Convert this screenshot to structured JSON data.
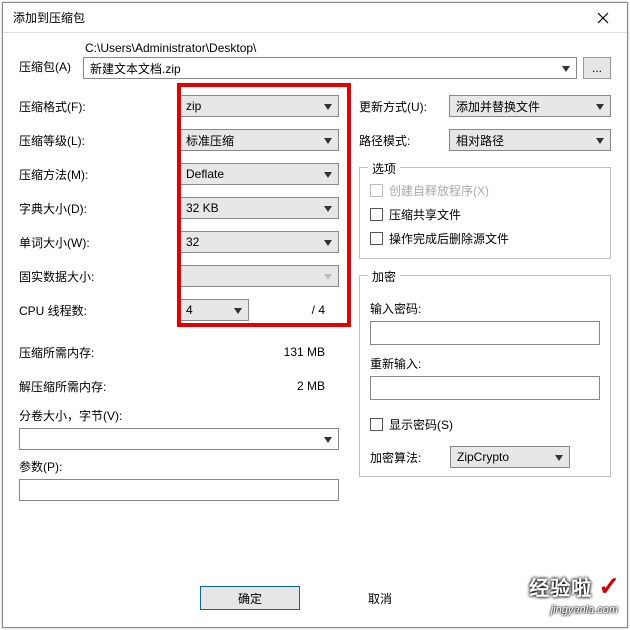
{
  "window": {
    "title": "添加到压缩包"
  },
  "top": {
    "archive_label": "压缩包(A)",
    "path": "C:\\Users\\Administrator\\Desktop\\",
    "archive_name": "新建文本文档.zip",
    "browse": "..."
  },
  "left": {
    "format_label": "压缩格式(F):",
    "format_value": "zip",
    "level_label": "压缩等级(L):",
    "level_value": "标准压缩",
    "method_label": "压缩方法(M):",
    "method_value": "Deflate",
    "dict_label": "字典大小(D):",
    "dict_value": "32 KB",
    "word_label": "单词大小(W):",
    "word_value": "32",
    "solid_label": "固实数据大小:",
    "solid_value": "",
    "cpu_label": "CPU 线程数:",
    "cpu_value": "4",
    "cpu_total": "/ 4",
    "mem_comp_label": "压缩所需内存:",
    "mem_comp_value": "131 MB",
    "mem_decomp_label": "解压缩所需内存:",
    "mem_decomp_value": "2 MB",
    "split_label": "分卷大小，字节(V):",
    "params_label": "参数(P):"
  },
  "right": {
    "update_label": "更新方式(U):",
    "update_value": "添加并替换文件",
    "path_mode_label": "路径模式:",
    "path_mode_value": "相对路径",
    "options_legend": "选项",
    "opt_sfx": "创建自释放程序(X)",
    "opt_share": "压缩共享文件",
    "opt_delete": "操作完成后删除源文件",
    "enc_legend": "加密",
    "enc_pwd_label": "输入密码:",
    "enc_repwd_label": "重新输入:",
    "enc_show": "显示密码(S)",
    "enc_algo_label": "加密算法:",
    "enc_algo_value": "ZipCrypto"
  },
  "footer": {
    "ok": "确定",
    "cancel": "取消"
  },
  "watermark": {
    "brand": "经验啦",
    "url": "jingyanla.com"
  }
}
